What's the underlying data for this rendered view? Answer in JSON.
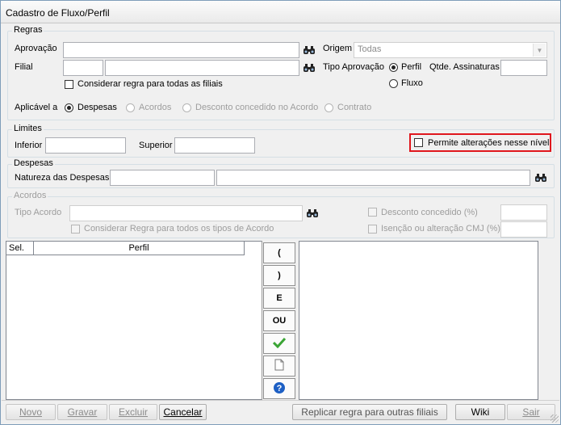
{
  "window": {
    "title": "Cadastro de Fluxo/Perfil"
  },
  "regras": {
    "title": "Regras",
    "aprovacao_label": "Aprovação",
    "filial_label": "Filial",
    "origem_label": "Origem",
    "origem_value": "Todas",
    "tipo_aprovacao_label": "Tipo Aprovação",
    "perfil_label": "Perfil",
    "fluxo_label": "Fluxo",
    "qtde_label": "Qtde. Assinaturas",
    "considerar_label": "Considerar regra para todas as filiais",
    "aplicavel_label": "Aplicável a",
    "aplicavel_options": [
      "Despesas",
      "Acordos",
      "Desconto concedido no Acordo",
      "Contrato"
    ]
  },
  "limites": {
    "title": "Limites",
    "inferior_label": "Inferior",
    "superior_label": "Superior",
    "permite_label": "Permite alterações nesse nível"
  },
  "despesas": {
    "title": "Despesas",
    "natureza_label": "Natureza das Despesas"
  },
  "acordos": {
    "title": "Acordos",
    "tipo_label": "Tipo Acordo",
    "considerar_label": "Considerar Regra para todos os tipos de Acordo",
    "desconto_label": "Desconto concedido (%)",
    "isencao_label": "Isenção ou alteração CMJ (%)"
  },
  "grid": {
    "col_sel": "Sel.",
    "col_perfil": "Perfil"
  },
  "operators": [
    "(",
    ")",
    "E",
    "OU"
  ],
  "buttons": {
    "novo": "Novo",
    "gravar": "Gravar",
    "excluir": "Excluir",
    "cancelar": "Cancelar",
    "replicar": "Replicar regra para outras filiais",
    "wiki": "Wiki",
    "sair": "Sair"
  },
  "colors": {
    "highlight": "#e0161d",
    "check_green": "#3aa435",
    "help_blue": "#1d5fc4"
  }
}
